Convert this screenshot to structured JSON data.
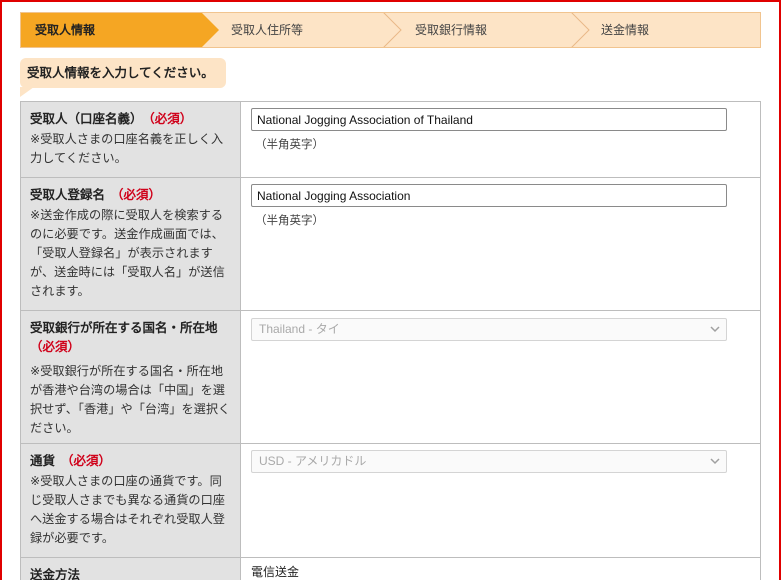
{
  "steps": [
    {
      "label": "受取人情報",
      "active": true
    },
    {
      "label": "受取人住所等",
      "active": false
    },
    {
      "label": "受取銀行情報",
      "active": false
    },
    {
      "label": "送金情報",
      "active": false
    }
  ],
  "bubble": "受取人情報を入力してください。",
  "required_label": "（必須）",
  "fields": {
    "account_name": {
      "title": "受取人（口座名義）",
      "note": "※受取人さまの口座名義を正しく入力してください。",
      "value": "National Jogging Association of Thailand",
      "hint": "（半角英字）"
    },
    "registered_name": {
      "title": "受取人登録名",
      "note": "※送金作成の際に受取人を検索するのに必要です。送金作成画面では、「受取人登録名」が表示されますが、送金時には「受取人名」が送信されます。",
      "value": "National Jogging Association",
      "hint": "（半角英字）"
    },
    "bank_country": {
      "title": "受取銀行が所在する国名・所在地",
      "note": "※受取銀行が所在する国名・所在地が香港や台湾の場合は「中国」を選択せず、「香港」や「台湾」を選択ください。",
      "selected": "Thailand - タイ"
    },
    "currency": {
      "title": "通貨",
      "note": "※受取人さまの口座の通貨です。同じ受取人さまでも異なる通貨の口座へ送金する場合はそれぞれ受取人登録が必要です。",
      "selected": "USD - アメリカドル"
    },
    "method": {
      "title": "送金方法",
      "value": "電信送金"
    }
  },
  "colors": {
    "step_active": "#f5a623",
    "step_inactive": "#fde4c6",
    "required": "#d0021b",
    "frame": "#e00000"
  }
}
